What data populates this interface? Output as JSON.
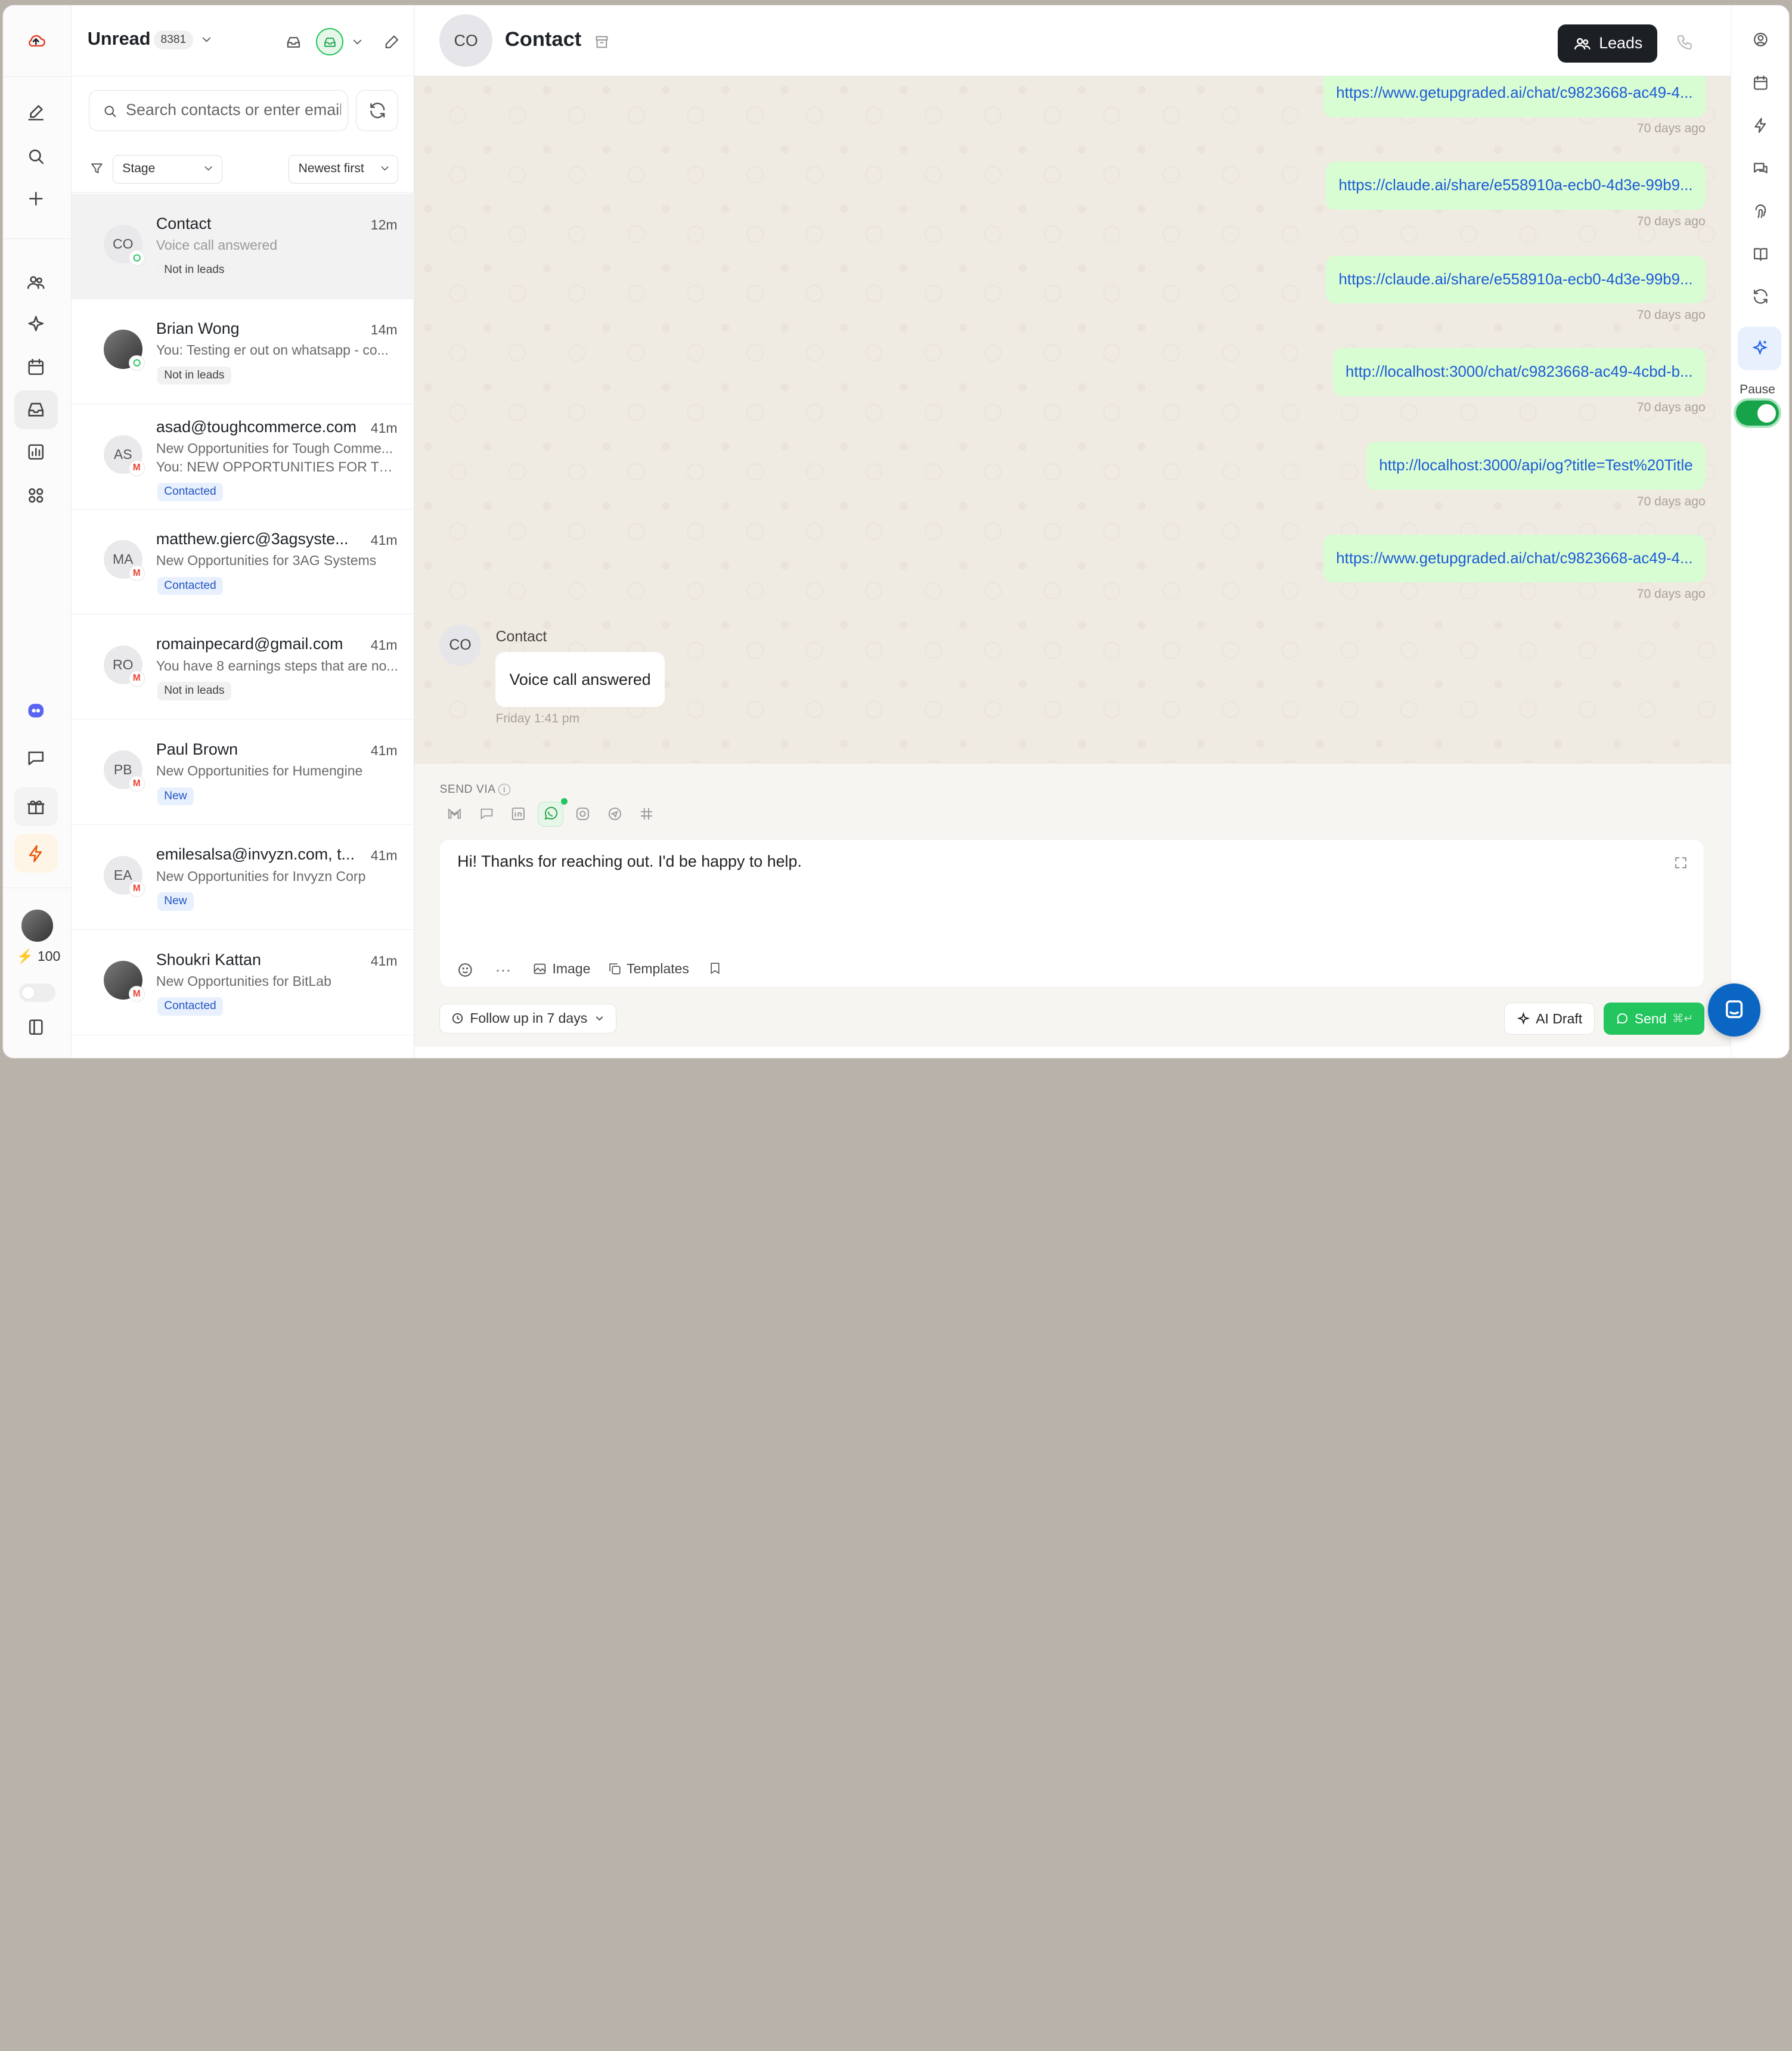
{
  "inbox": {
    "title": "Unread",
    "count": "8381"
  },
  "search": {
    "placeholder": "Search contacts or enter email"
  },
  "filters": {
    "stage": "Stage",
    "sort": "Newest first"
  },
  "conversations": [
    {
      "initials": "CO",
      "name": "Contact",
      "time": "12m",
      "preview": "Voice call answered",
      "preview2": "",
      "tag": "Not in leads",
      "channel": "whatsapp"
    },
    {
      "initials": "",
      "name": "Brian Wong",
      "time": "14m",
      "preview": "You: Testing er out on whatsapp - co...",
      "preview2": "",
      "tag": "Not in leads",
      "channel": "whatsapp"
    },
    {
      "initials": "AS",
      "name": "asad@toughcommerce.com",
      "time": "41m",
      "preview": "New Opportunities for Tough Comme...",
      "preview2": "You: NEW OPPORTUNITIES FOR TOU...",
      "tag": "Contacted",
      "channel": "gmail"
    },
    {
      "initials": "MA",
      "name": "matthew.gierc@3agsyste...",
      "time": "41m",
      "preview": "New Opportunities for 3AG Systems",
      "preview2": "",
      "tag": "Contacted",
      "channel": "gmail"
    },
    {
      "initials": "RO",
      "name": "romainpecard@gmail.com",
      "time": "41m",
      "preview": "You have 8 earnings steps that are no...",
      "preview2": "",
      "tag": "Not in leads",
      "channel": "gmail"
    },
    {
      "initials": "PB",
      "name": "Paul Brown",
      "time": "41m",
      "preview": "New Opportunities for Humengine",
      "preview2": "",
      "tag": "New",
      "channel": "gmail"
    },
    {
      "initials": "EA",
      "name": "emilesalsa@invyzn.com, t...",
      "time": "41m",
      "preview": "New Opportunities for Invyzn Corp",
      "preview2": "",
      "tag": "New",
      "channel": "gmail"
    },
    {
      "initials": "",
      "name": "Shoukri Kattan",
      "time": "41m",
      "preview": "New Opportunities for BitLab",
      "preview2": "",
      "tag": "Contacted",
      "channel": "gmail"
    }
  ],
  "rail": {
    "credits": "100"
  },
  "chat": {
    "initials": "CO",
    "title": "Contact",
    "leads_label": "Leads",
    "outgoing": [
      {
        "text": "https://www.getupgraded.ai/chat/c9823668-ac49-4...",
        "time": "70 days ago"
      },
      {
        "text": "https://claude.ai/share/e558910a-ecb0-4d3e-99b9...",
        "time": "70 days ago"
      },
      {
        "text": "https://claude.ai/share/e558910a-ecb0-4d3e-99b9...",
        "time": "70 days ago"
      },
      {
        "text": "http://localhost:3000/chat/c9823668-ac49-4cbd-b...",
        "time": "70 days ago"
      },
      {
        "text": "http://localhost:3000/api/og?title=Test%20Title",
        "time": "70 days ago"
      },
      {
        "text": "https://www.getupgraded.ai/chat/c9823668-ac49-4...",
        "time": "70 days ago"
      }
    ],
    "incoming": {
      "sender": "Contact",
      "initials": "CO",
      "text": "Voice call answered",
      "time": "Friday 1:41 pm"
    }
  },
  "composer": {
    "send_via": "SEND VIA",
    "draft_text": "Hi! Thanks for reaching out. I'd be happy to help.",
    "image_label": "Image",
    "templates_label": "Templates",
    "followup_label": "Follow up in 7 days",
    "ai_draft_label": "AI Draft",
    "send_label": "Send",
    "send_shortcut": "⌘↵"
  },
  "right_rail": {
    "pause_label": "Pause",
    "pause_on": true
  },
  "colors": {
    "accent_green": "#22c55e",
    "leads_button": "#1c1f24",
    "outgoing_bubble": "#d9fdd3",
    "link": "#1d5bd6"
  }
}
